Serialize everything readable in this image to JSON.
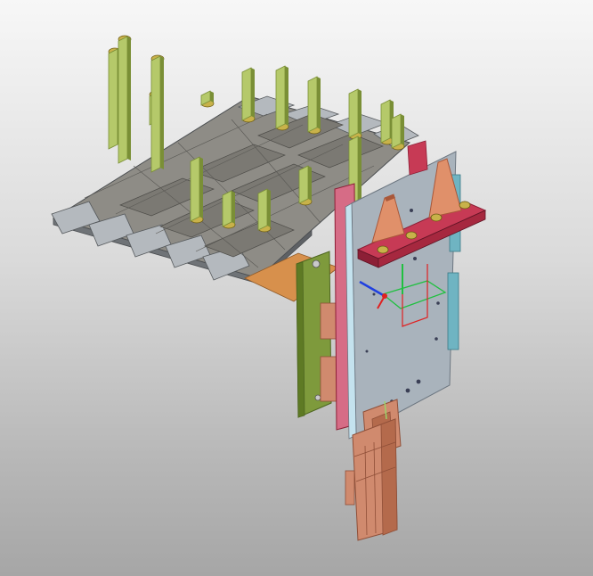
{
  "viewport": {
    "background_top": "#f7f7f7",
    "background_bottom": "#a6a6a6"
  },
  "colors": {
    "tray_plate": "#a8adb2",
    "tray_dark": "#6f7377",
    "tray_edge": "#4a4d50",
    "pin_green": "#b5c96a",
    "pin_dark": "#7a8f36",
    "pin_base": "#c8b24a",
    "back_plate": "#a9b3bc",
    "back_plate_edge": "#6c7680",
    "crimson_bracket": "#c73a55",
    "crimson_dark": "#8c1f36",
    "salmon_gusset": "#e0906a",
    "salmon_dark": "#a9583a",
    "side_green": "#7e9a3c",
    "side_green_dark": "#4e6620",
    "pink_panel": "#d66c86",
    "copper_cylinder": "#d08a6e",
    "copper_dark": "#8f4f38",
    "orange_strap": "#d7904c",
    "teal_rail": "#6fb4c2",
    "triad_x": "#e02020",
    "triad_y": "#20c040",
    "triad_z": "#2040e0"
  },
  "icons": {
    "triad": "coordinate-triad-icon"
  }
}
